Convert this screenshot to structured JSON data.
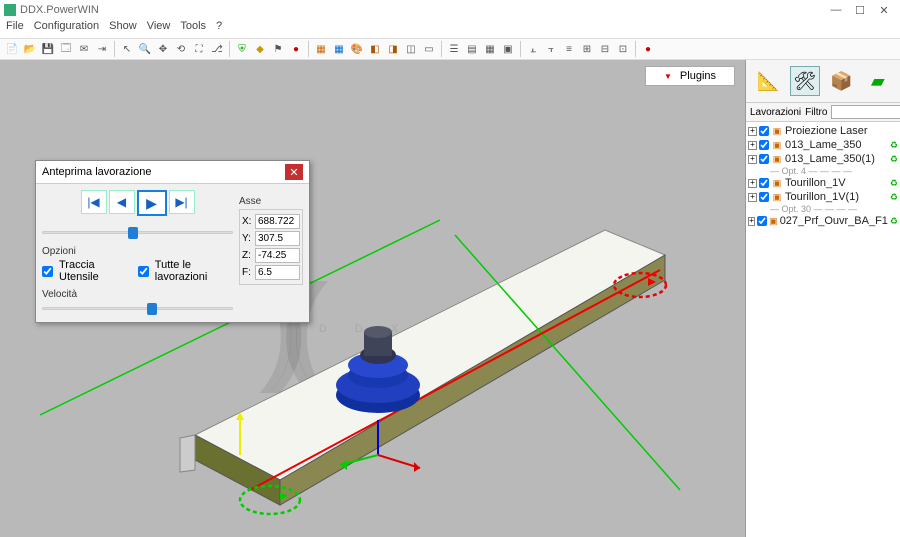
{
  "app": {
    "title": "DDX.PowerWIN"
  },
  "menu": {
    "file": "File",
    "configuration": "Configuration",
    "show": "Show",
    "view": "View",
    "tools": "Tools",
    "help": "?"
  },
  "plugins_button": "Plugins",
  "dialog": {
    "title": "Anteprima lavorazione",
    "opzioni_label": "Opzioni",
    "traccia_utensile": "Traccia Utensile",
    "tutte_lavorazioni": "Tutte le lavorazioni",
    "velocita_label": "Velocità",
    "asse_label": "Asse",
    "axes": {
      "x": "688.722",
      "y": "307.5",
      "z": "-74.25",
      "f": "6.5"
    }
  },
  "rightpane": {
    "lavorazioni_label": "Lavorazioni",
    "filtro_label": "Filtro",
    "filtro_value": "",
    "tree": [
      {
        "label": "Proiezione Laser",
        "hasGreen": false
      },
      {
        "label": "013_Lame_350",
        "hasGreen": true
      },
      {
        "label": "013_Lame_350(1)",
        "hasGreen": true
      },
      {
        "opt": "Opt. 4"
      },
      {
        "label": "Tourillon_1V",
        "hasGreen": true
      },
      {
        "label": "Tourillon_1V(1)",
        "hasGreen": true
      },
      {
        "opt": "Opt. 30"
      },
      {
        "label": "027_Prf_Ouvr_BA_F1",
        "hasGreen": true
      }
    ]
  },
  "watermark": "DDX"
}
